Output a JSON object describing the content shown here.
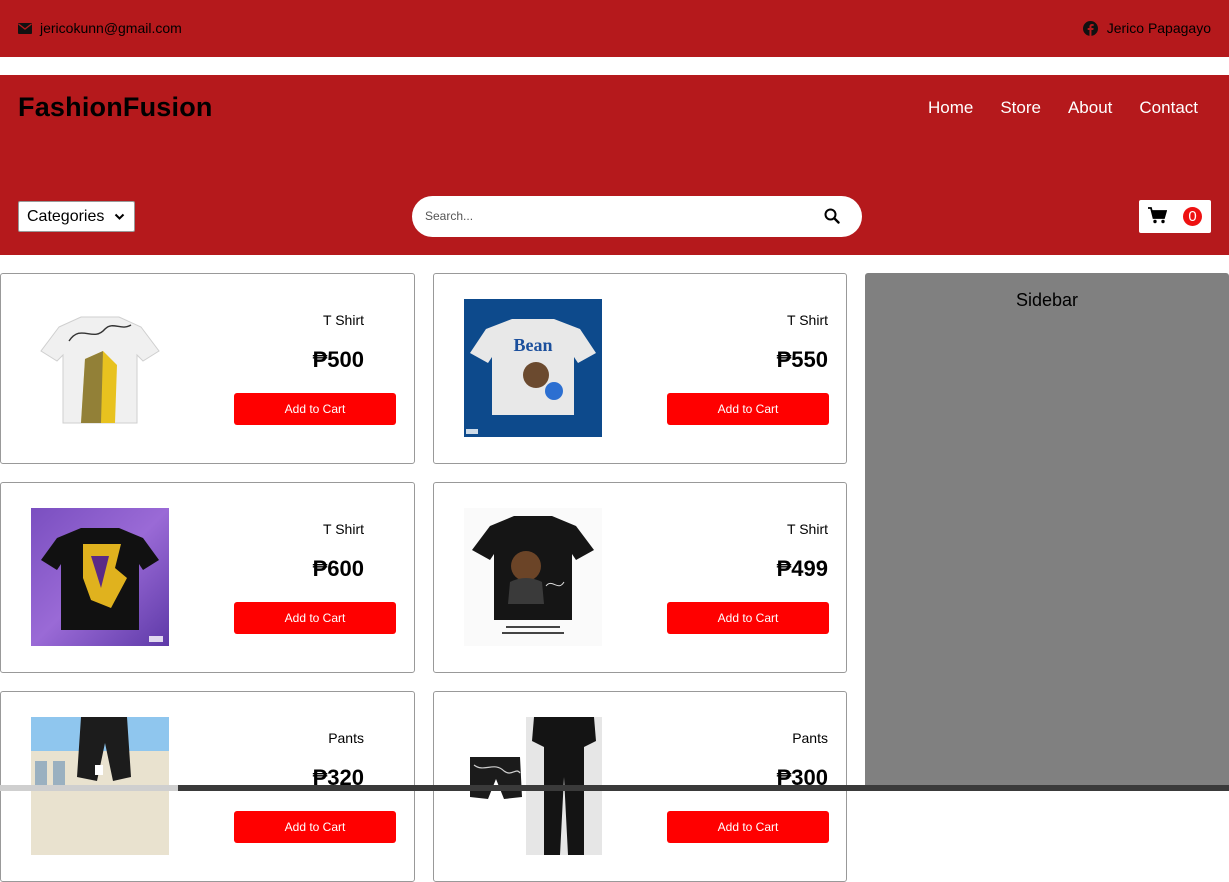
{
  "topbar": {
    "email": "jericokunn@gmail.com",
    "social_name": "Jerico Papagayo",
    "email_icon": "envelope-icon",
    "social_icon": "facebook-icon"
  },
  "header": {
    "brand": "FashionFusion",
    "nav": [
      "Home",
      "Store",
      "About",
      "Contact"
    ]
  },
  "toolbar": {
    "categories_label": "Categories",
    "search_placeholder": "Search...",
    "cart_count": "0"
  },
  "products": [
    {
      "name": "T Shirt",
      "price": "₱500",
      "button": "Add to Cart"
    },
    {
      "name": "T Shirt",
      "price": "₱550",
      "button": "Add to Cart"
    },
    {
      "name": "T Shirt",
      "price": "₱600",
      "button": "Add to Cart"
    },
    {
      "name": "T Shirt",
      "price": "₱499",
      "button": "Add to Cart"
    },
    {
      "name": "Pants",
      "price": "₱320",
      "button": "Add to Cart"
    },
    {
      "name": "Pants",
      "price": "₱300",
      "button": "Add to Cart"
    }
  ],
  "product_images": {
    "p2_text": "Bean"
  },
  "sidebar": {
    "title": "Sidebar"
  },
  "colors": {
    "header_bg": "#b5191c",
    "button_bg": "#ff0000",
    "sidebar_bg": "#808080"
  }
}
